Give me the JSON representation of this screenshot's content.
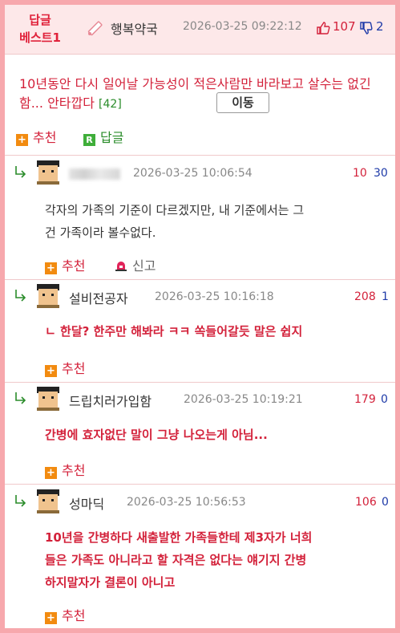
{
  "header": {
    "badge_line1": "답글",
    "badge_line2": "베스트1",
    "author": "행복약국",
    "timestamp": "2026-03-25 09:22:12",
    "upvotes": "107",
    "downvotes": "2",
    "icons": [
      "pencil-icon",
      "thumbs-up-icon",
      "thumbs-down-icon"
    ]
  },
  "post": {
    "text": "10년동안 다시 일어날 가능성이 적은사람만 바라보고 살수는 없긴함... 안타깝다",
    "reply_count": "[42]",
    "move_button": "이동",
    "recommend_label": "추천",
    "reply_label": "답글"
  },
  "comments": [
    {
      "author": "",
      "author_blurred": true,
      "timestamp": "2026-03-25 10:06:54",
      "upvotes": "10",
      "downvotes": "30",
      "text_line1": "각자의 가족의 기준이 다르겠지만, 내 기준에서는 그",
      "text_line2": "건 가족이라 볼수없다.",
      "recommend_label": "추천",
      "report_label": "신고"
    },
    {
      "author": "설비전공자",
      "timestamp": "2026-03-25 10:16:18",
      "upvotes": "208",
      "downvotes": "1",
      "text_line1": "ㄴ 한달? 한주만 해봐라 ㅋㅋ 쏙들어갈듯 말은 쉽지",
      "recommend_label": "추천"
    },
    {
      "author": "드립치러가입함",
      "timestamp": "2026-03-25 10:19:21",
      "upvotes": "179",
      "downvotes": "0",
      "text_line1": "간병에 효자없단 말이 그냥 나오는게 아님...",
      "recommend_label": "추천"
    },
    {
      "author": "성마딕",
      "timestamp": "2026-03-25 10:56:53",
      "upvotes": "106",
      "downvotes": "0",
      "text_line1": "10년을 간병하다 새출발한 가족들한테 제3자가 너희",
      "text_line2": "들은 가족도 아니라고 할 자격은 없다는 얘기지 간병",
      "text_line3": "하지말자가 결론이 아니고",
      "recommend_label": "추천"
    }
  ],
  "colors": {
    "frame": "#f7a8ad",
    "header_bg": "#fde8e9",
    "accent_red": "#d3213a",
    "down_blue": "#1e3aa8",
    "reply_green": "#2a8c2a",
    "recommend_orange": "#f28b10"
  }
}
